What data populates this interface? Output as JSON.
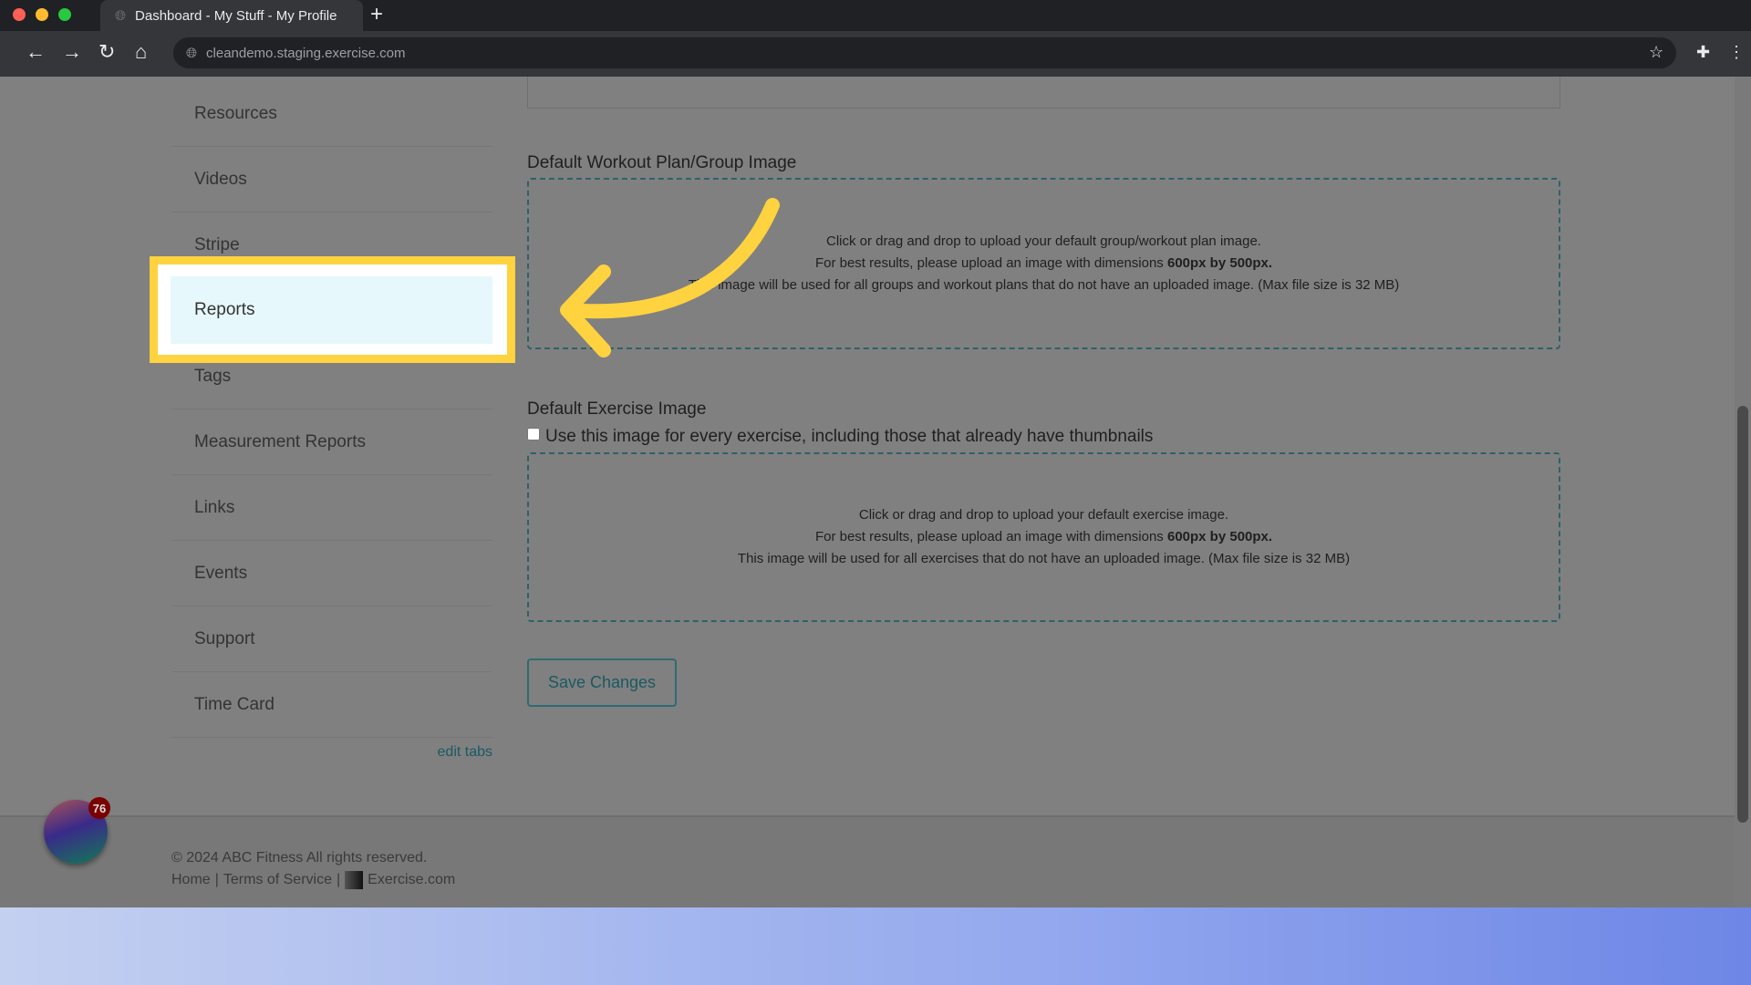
{
  "browser": {
    "tab_title": "Dashboard - My Stuff - My Profile",
    "url": "cleandemo.staging.exercise.com",
    "new_tab": "+"
  },
  "sidebar": {
    "items": [
      {
        "label": "Resources"
      },
      {
        "label": "Videos"
      },
      {
        "label": "Stripe"
      },
      {
        "label": "Reports"
      },
      {
        "label": "Tags"
      },
      {
        "label": "Measurement Reports"
      },
      {
        "label": "Links"
      },
      {
        "label": "Events"
      },
      {
        "label": "Support"
      },
      {
        "label": "Time Card"
      }
    ],
    "edit_tabs": "edit tabs",
    "highlighted": "Reports"
  },
  "main": {
    "workout_image": {
      "label": "Default Workout Plan/Group Image",
      "line1": "Click or drag and drop to upload your default group/workout plan image.",
      "line2_pre": "For best results, please upload an image with dimensions ",
      "line2_bold": "600px by 500px.",
      "line3": "This image will be used for all groups and workout plans that do not have an uploaded image. (Max file size is 32 MB)"
    },
    "exercise_image": {
      "label": "Default Exercise Image",
      "checkbox_label": "Use this image for every exercise, including those that already have thumbnails",
      "checkbox_checked": false,
      "line1": "Click or drag and drop to upload your default exercise image.",
      "line2_pre": "For best results, please upload an image with dimensions ",
      "line2_bold": "600px by 500px.",
      "line3": "This image will be used for all exercises that do not have an uploaded image. (Max file size is 32 MB)"
    },
    "save_label": "Save Changes"
  },
  "footer": {
    "copyright": "© 2024 ABC Fitness All rights reserved.",
    "links": [
      "Home",
      "Terms of Service",
      "Exercise.com"
    ],
    "sep": "|"
  },
  "widget": {
    "badge": "76"
  },
  "colors": {
    "highlight": "#ffd23f",
    "accent": "#2e6b73"
  }
}
